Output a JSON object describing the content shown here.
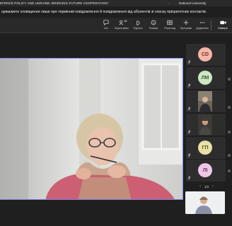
{
  "window": {
    "title": "EFENCE POLICY AND UKRAINE: BRIDGING FUTURE COOPERATION\"",
    "dots": "···",
    "right_text": "National University"
  },
  "banner": {
    "text": "ауваємете сповіщення лише про термінові повідомлення й повідомлення від абонентів зі списку пріоритетних контактів."
  },
  "toolbar": {
    "chat": "Чат",
    "people": "Користувачі",
    "people_count": "18",
    "raise": "Підняти",
    "react": "Реакція",
    "view": "Перегляд",
    "apps": "Програми",
    "more": "Додатково",
    "camera": "Камера"
  },
  "participants": [
    {
      "initials": "CD",
      "color": "#f4b6a8",
      "text_color": "#7a2f22"
    },
    {
      "initials": "ЛМ",
      "color": "#cde6c3",
      "text_color": "#3a5a2e"
    },
    {
      "initials": "ГП",
      "color": "#e8e0a6",
      "text_color": "#5a5218"
    },
    {
      "initials": "ЛІ",
      "color": "#f0c7e8",
      "text_color": "#6a2f5e"
    }
  ],
  "pager": {
    "text": "1/3"
  }
}
